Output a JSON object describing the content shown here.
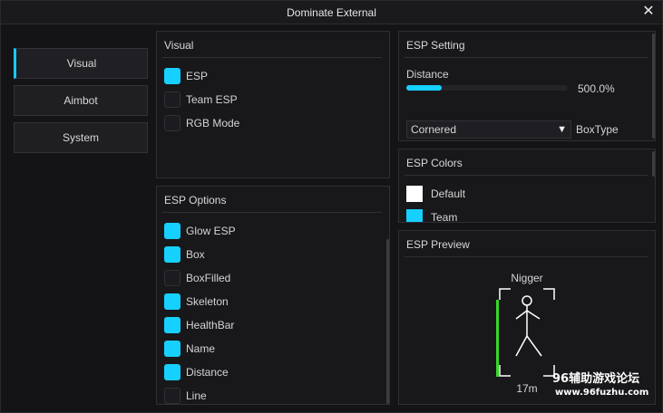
{
  "window": {
    "title": "Dominate External",
    "close_glyph": "✕"
  },
  "nav": {
    "items": [
      {
        "label": "Visual"
      },
      {
        "label": "Aimbot"
      },
      {
        "label": "System"
      }
    ]
  },
  "visual": {
    "title": "Visual",
    "items": [
      {
        "label": "ESP",
        "checked": true
      },
      {
        "label": "Team ESP",
        "checked": false
      },
      {
        "label": "RGB Mode",
        "checked": false
      }
    ]
  },
  "esp_options": {
    "title": "ESP Options",
    "items": [
      {
        "label": "Glow ESP",
        "checked": true
      },
      {
        "label": "Box",
        "checked": true
      },
      {
        "label": "BoxFilled",
        "checked": false
      },
      {
        "label": "Skeleton",
        "checked": true
      },
      {
        "label": "HealthBar",
        "checked": true
      },
      {
        "label": "Name",
        "checked": true
      },
      {
        "label": "Distance",
        "checked": true
      },
      {
        "label": "Line",
        "checked": false
      }
    ]
  },
  "esp_setting": {
    "title": "ESP Setting",
    "distance_label": "Distance",
    "distance_value": "500.0%",
    "distance_fraction": 0.22,
    "box_type_value": "Cornered",
    "box_type_label": "BoxType",
    "dropdown_arrow": "▼"
  },
  "esp_colors": {
    "title": "ESP Colors",
    "items": [
      {
        "label": "Default",
        "color": "#ffffff"
      },
      {
        "label": "Team",
        "color": "#16d0ff"
      }
    ]
  },
  "esp_preview": {
    "title": "ESP Preview",
    "name": "Nigger",
    "distance": "17m",
    "health_color": "#39d52b",
    "health_fraction": 1.0
  },
  "watermark": {
    "line1": "96辅助游戏论坛",
    "line2": "www.96fuzhu.com"
  },
  "colors": {
    "accent": "#16d0ff",
    "background": "#141417",
    "panel": "#18181b"
  }
}
